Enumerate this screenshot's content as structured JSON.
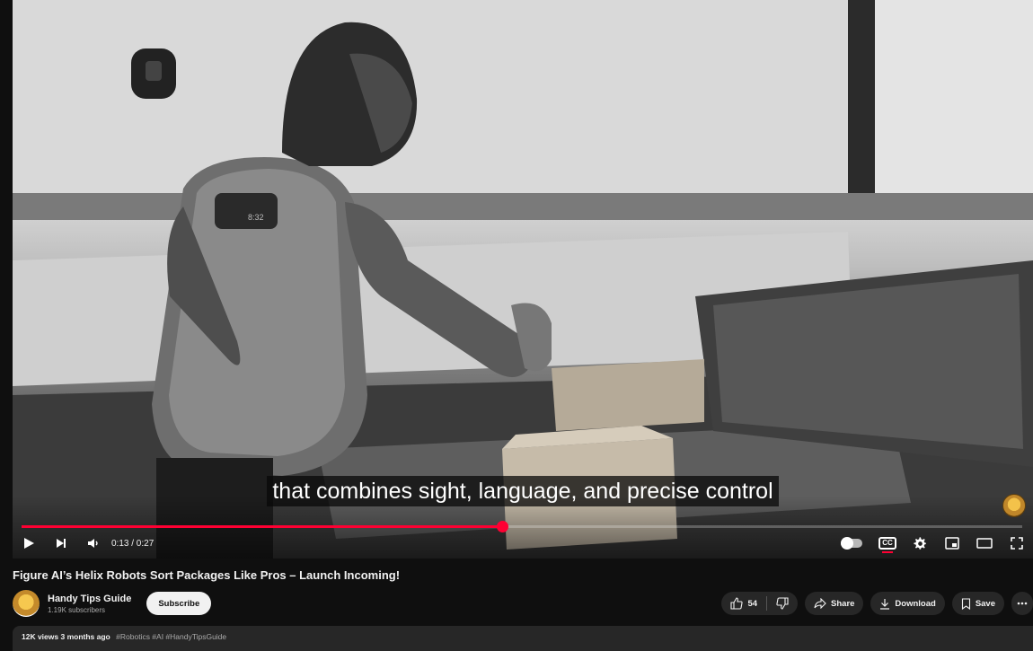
{
  "player": {
    "caption": "that combines sight, language, and precise control",
    "current_time": "0:13",
    "duration": "0:27",
    "time_display": "0:13 / 0:27",
    "progress_fraction": 0.48,
    "cc_label": "CC",
    "accent_color": "#ff0033"
  },
  "video": {
    "title": "Figure AI’s Helix Robots Sort Packages Like Pros – Launch Incoming!",
    "channel_name": "Handy Tips Guide",
    "subscribers": "1.19K subscribers",
    "subscribe_label": "Subscribe",
    "like_count": "54",
    "share_label": "Share",
    "download_label": "Download",
    "save_label": "Save"
  },
  "description": {
    "views": "12K views",
    "age": "3 months ago",
    "tags": "#Robotics #AI #HandyTipsGuide"
  },
  "icons": [
    "play-icon",
    "next-icon",
    "volume-icon",
    "autoplay-toggle",
    "subtitles-icon",
    "settings-icon",
    "miniplayer-icon",
    "theater-icon",
    "fullscreen-icon",
    "like-icon",
    "dislike-icon",
    "share-icon",
    "download-icon",
    "save-icon",
    "more-icon"
  ]
}
